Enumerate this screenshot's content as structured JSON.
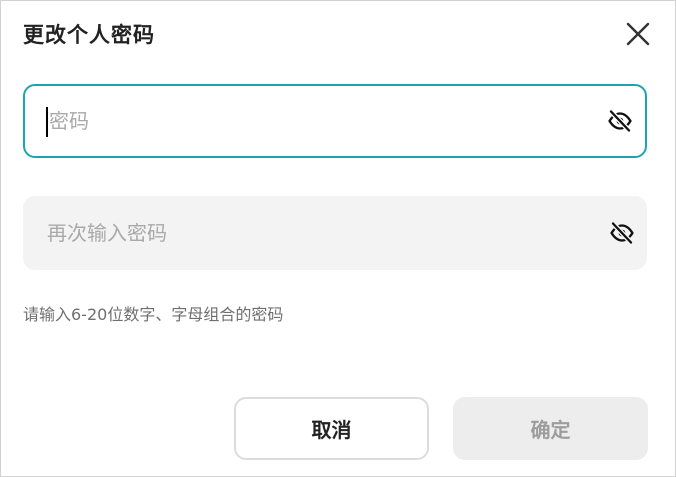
{
  "dialog": {
    "title": "更改个人密码",
    "password": {
      "value": "",
      "placeholder": "密码",
      "visibility_icon": "eye-off-icon"
    },
    "confirm_password": {
      "value": "",
      "placeholder": "再次输入密码",
      "visibility_icon": "eye-off-icon"
    },
    "hint": "请输入6-20位数字、字母组合的密码",
    "cancel_label": "取消",
    "confirm_label": "确定",
    "close_icon": "close-icon"
  },
  "colors": {
    "accent": "#1aa6b0",
    "field_background": "#f3f3f3",
    "disabled_button_background": "#ededed",
    "disabled_text": "#9d9d9d",
    "hint_text": "#6f6f6f"
  }
}
